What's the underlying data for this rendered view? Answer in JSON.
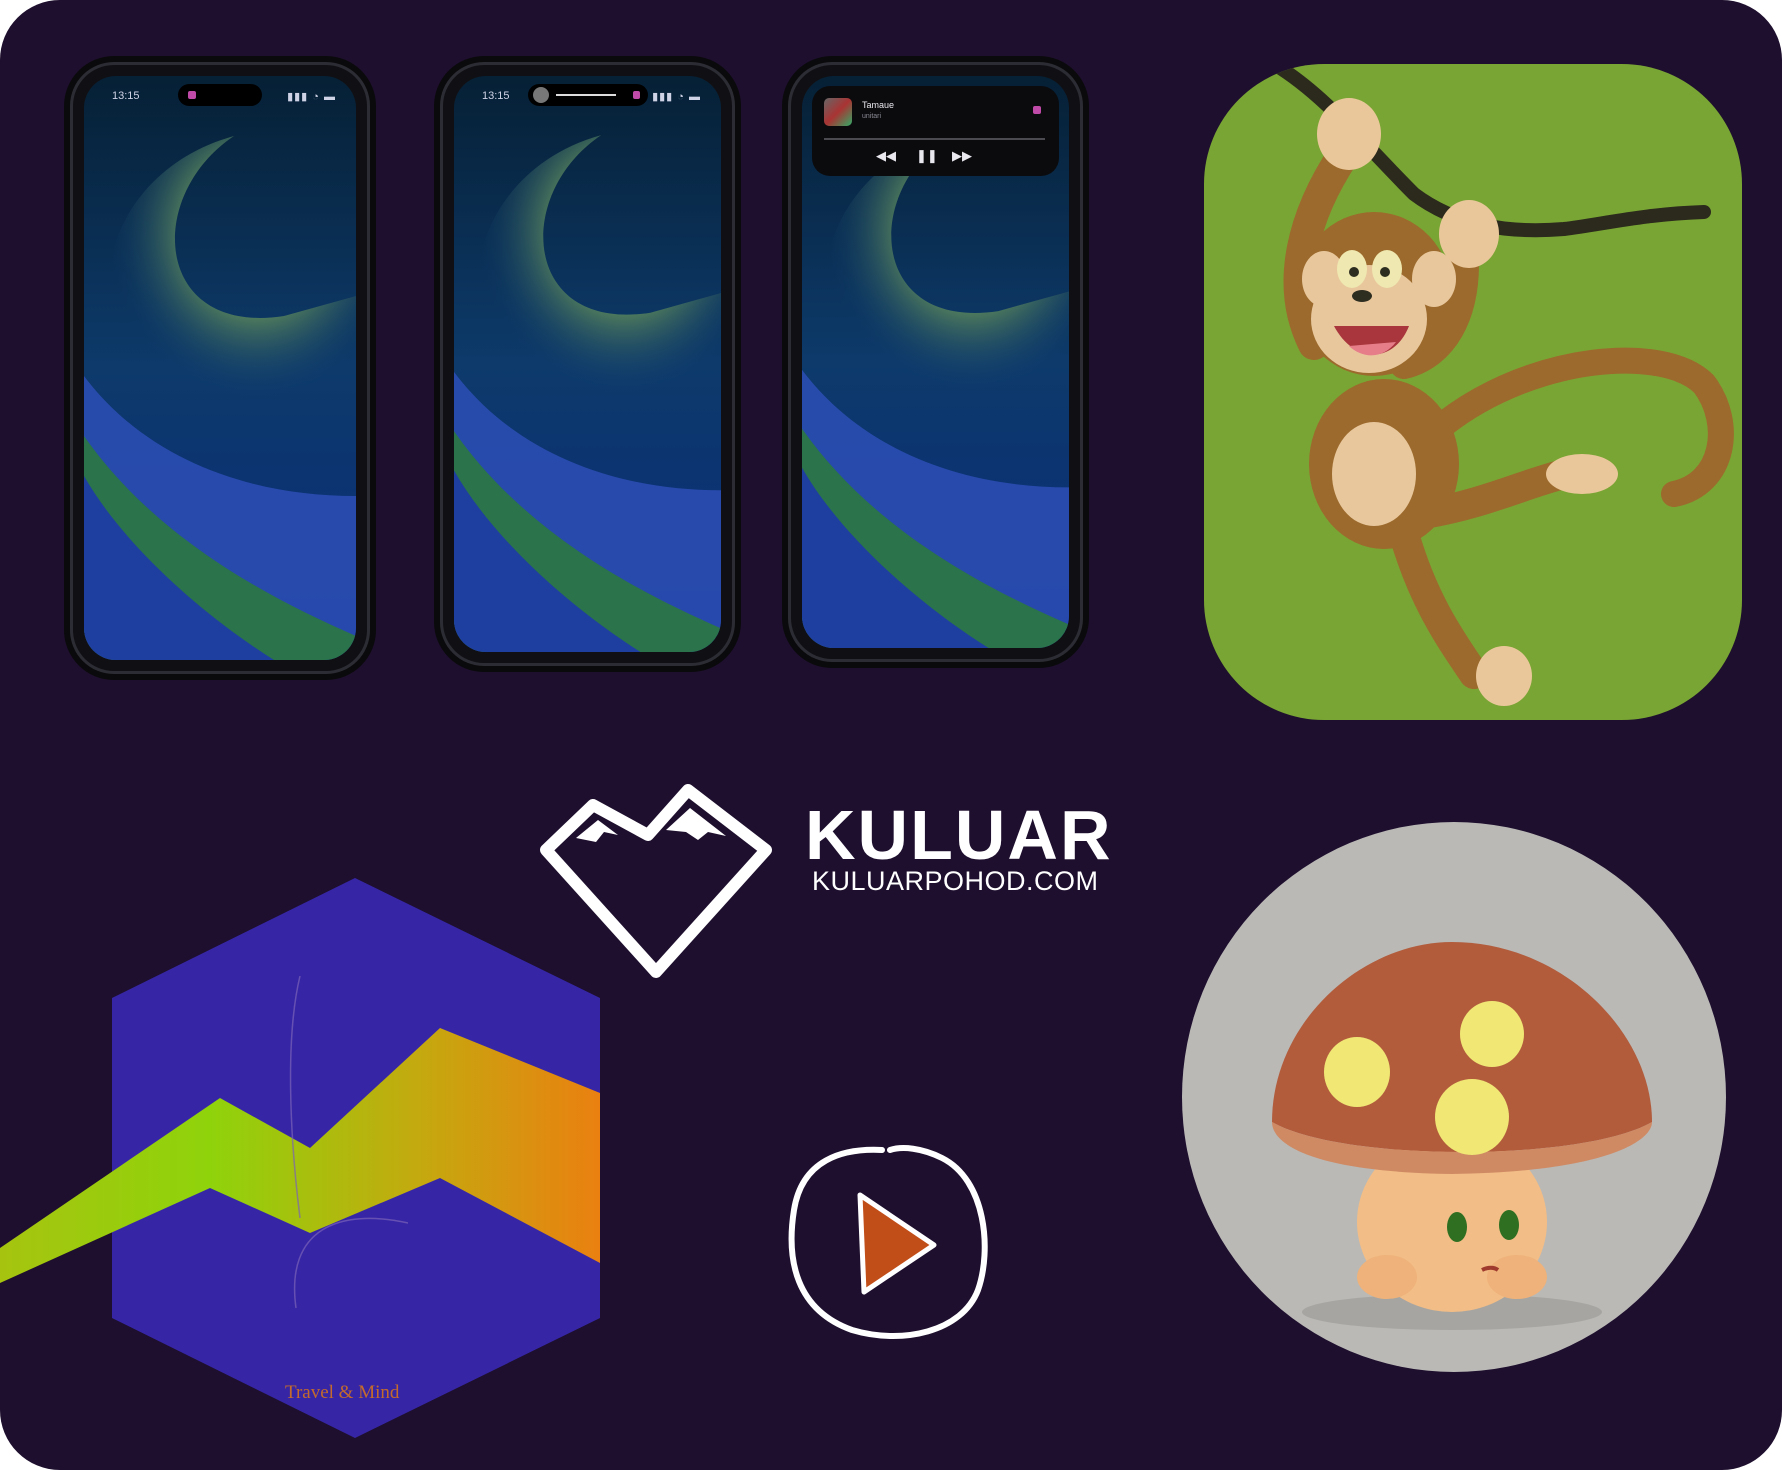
{
  "phones": [
    {
      "time": "13:15",
      "signal": "▮▮▮ ◔ ▬"
    },
    {
      "time": "13:15",
      "signal": "▮▮▮ ◔ ▬"
    },
    {
      "time": "",
      "signal": ""
    }
  ],
  "media_widget": {
    "track_title": "Tamaue",
    "track_artist": "unitari",
    "controls": [
      "previous",
      "pause",
      "next"
    ]
  },
  "kuluar": {
    "title": "KULUAR",
    "url": "KULUARPOHOD.COM"
  },
  "travel_mind": {
    "label": "Travel & Mind"
  },
  "colors": {
    "background": "#1e0f2e",
    "monkey_bg": "#79a534",
    "mushroom_bg": "#bab9b6",
    "hexagon": "#3626a6",
    "play_arrow": "#c14d18"
  },
  "icons": [
    "phone-mockup",
    "monkey-illustration",
    "kuluar-mountain-heart-logo",
    "travel-mind-logo",
    "play-icon",
    "mushroom-character"
  ]
}
